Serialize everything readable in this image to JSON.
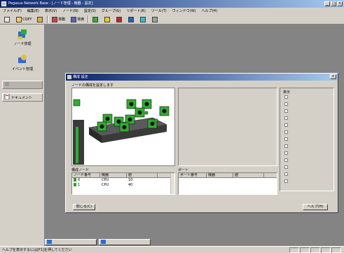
{
  "window": {
    "title": "Pegasus Network Base - [ノード管理 - 機器 - 設定]",
    "min_label": "_",
    "max_label": "□",
    "close_label": "×"
  },
  "menubar": {
    "items": [
      "ファイル(F)",
      "編集(E)",
      "表示(V)",
      "ノード(N)",
      "設定(S)",
      "グループ(G)",
      "リポート(R)",
      "ツール(T)",
      "ウィンドウ(W)",
      "ヘルプ(H)"
    ]
  },
  "toolbar": {
    "items": [
      {
        "icon": "new-icon",
        "label": "",
        "color": "#e8e8e8"
      },
      {
        "icon": "open-icon",
        "label": "COPY",
        "color": "#f0d060"
      },
      {
        "icon": "folder-icon",
        "label": "",
        "color": "#e0b040"
      },
      {
        "icon": "move-icon",
        "label": "移動",
        "color": "#d04040"
      },
      {
        "icon": "filter-icon",
        "label": "検索",
        "color": "#6060c0"
      },
      {
        "icon": "green-status-icon",
        "label": "",
        "color": "#30b030"
      },
      {
        "icon": "yellow-status-icon",
        "label": "",
        "color": "#e0d020"
      },
      {
        "icon": "red-status-icon",
        "label": "",
        "color": "#d02020"
      },
      {
        "icon": "blue-status-icon",
        "label": "",
        "color": "#2060d0"
      },
      {
        "icon": "cyan-status-icon",
        "label": "",
        "color": "#30c0d0"
      },
      {
        "icon": "gray-status-icon",
        "label": "",
        "color": "#a0a0a0"
      }
    ]
  },
  "leftpanel": {
    "buttons": [
      {
        "label": "ノード管理",
        "icon": "node-manage-icon"
      },
      {
        "label": "イベント管理",
        "icon": "event-manage-icon"
      }
    ],
    "rows": [
      {
        "label": "",
        "icon": "disabled-icon",
        "disabled": true
      },
      {
        "label": "ドキュメント",
        "icon": "document-icon",
        "disabled": false
      }
    ]
  },
  "dialog": {
    "title": "構成 設定",
    "subtitle": "ノードの構成を設定します",
    "close_label": "×",
    "left_grid": {
      "label": "構成ノード",
      "headers": [
        "ノード番号",
        "機器",
        "値"
      ],
      "rows": [
        [
          "0",
          "CPU",
          "10"
        ],
        [
          "1",
          "CPU",
          "40"
        ]
      ]
    },
    "right_grid": {
      "label": "ポート",
      "headers": [
        "ポート番号",
        "機器",
        "値"
      ]
    },
    "right_panel_label": "表示",
    "checkbox_count": 13,
    "buttons": {
      "left": "閉じる(C)",
      "right": "ヘルプ(H)"
    }
  },
  "taskbar": {
    "items": [
      {
        "label": "",
        "icon": "window-icon"
      },
      {
        "label": "",
        "icon": "window-icon"
      }
    ]
  },
  "statusbar": {
    "text": "ヘルプを表示するには[F1]を押してください",
    "cells": [
      "",
      "",
      "",
      "",
      ""
    ]
  }
}
